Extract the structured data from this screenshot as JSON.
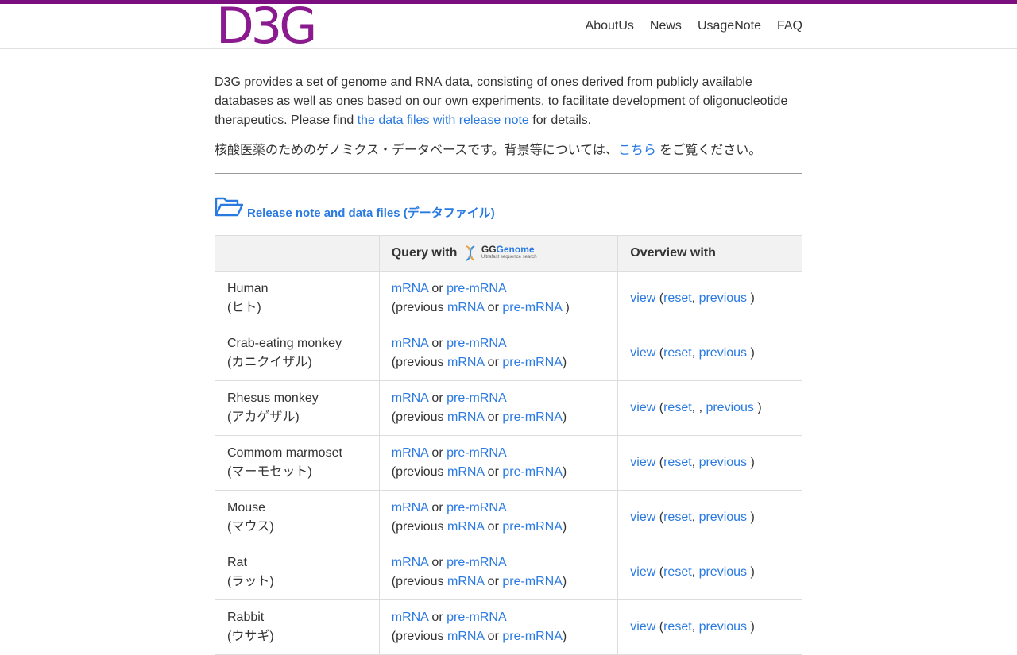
{
  "brand": {
    "logo": "D3G",
    "accent": "#7b0f7f",
    "link_color": "#2a7ae2"
  },
  "nav": [
    {
      "label": "AboutUs"
    },
    {
      "label": "News"
    },
    {
      "label": "UsageNote"
    },
    {
      "label": "FAQ"
    }
  ],
  "intro": {
    "text_before": "D3G provides a set of genome and RNA data, consisting of ones derived from publicly available databases as well as ones based on our own experiments, to facilitate development of oligonucleotide therapeutics. Please find ",
    "link": "the data files with release note",
    "text_after": " for details."
  },
  "intro_ja": {
    "before": "核酸医薬のためのゲノミクス・データベースです。背景等については、",
    "link": "こちら",
    "after": " をご覧ください。"
  },
  "section": {
    "icon": "folder-open-icon",
    "title": "Release note and data files (データファイル)"
  },
  "table": {
    "headers": {
      "col1": "",
      "col2_prefix": "Query with",
      "col2_logo_main_a": "GG",
      "col2_logo_main_b": "Genome",
      "col2_logo_sub": "Ultrafast sequence search",
      "col3": "Overview with"
    },
    "labels": {
      "mrna": "mRNA",
      "or": " or ",
      "premrna": "pre-mRNA",
      "previous_open": "(previous ",
      "view": "view",
      "reset": "reset",
      "previous": "previous"
    },
    "rows": [
      {
        "name": "Human",
        "ja": "(ヒト)"
      },
      {
        "name": "Crab-eating monkey",
        "ja": "(カニクイザル)"
      },
      {
        "name": "Rhesus monkey",
        "ja": "(アカゲザル)"
      },
      {
        "name": "Commom marmoset",
        "ja": "(マーモセット)"
      },
      {
        "name": "Mouse",
        "ja": "(マウス)"
      },
      {
        "name": "Rat",
        "ja": "(ラット)"
      },
      {
        "name": "Rabbit",
        "ja": "(ウサギ)"
      }
    ]
  }
}
